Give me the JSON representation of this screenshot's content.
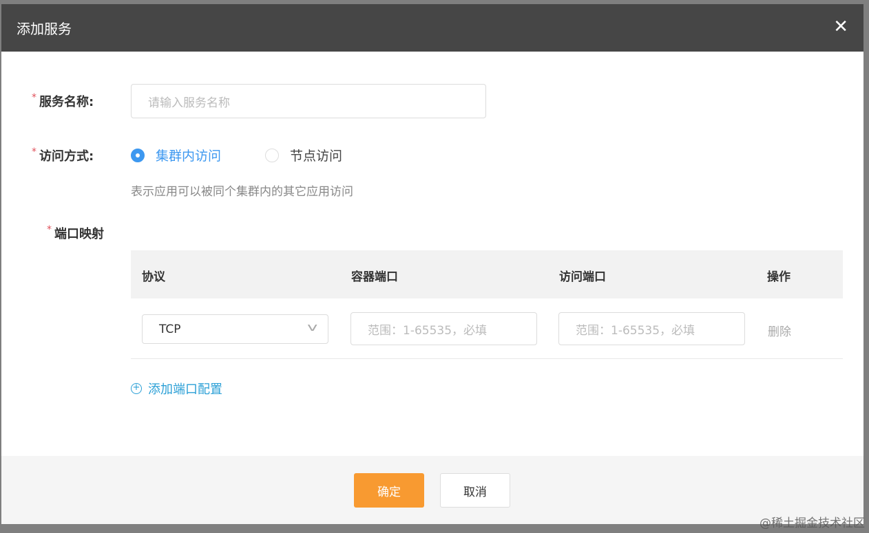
{
  "dialog": {
    "title": "添加服务",
    "close_icon": "close-icon"
  },
  "form": {
    "service_name": {
      "label": "服务名称:",
      "placeholder": "请输入服务名称",
      "value": ""
    },
    "access_mode": {
      "label": "访问方式:",
      "options": [
        "集群内访问",
        "节点访问"
      ],
      "selected": "集群内访问",
      "hint": "表示应用可以被同个集群内的其它应用访问"
    },
    "port_mapping": {
      "label": "端口映射",
      "columns": [
        "协议",
        "容器端口",
        "访问端口",
        "操作"
      ],
      "rows": [
        {
          "protocol": "TCP",
          "container_port_placeholder": "范围：1-65535，必填",
          "access_port_placeholder": "范围：1-65535，必填",
          "action": "删除"
        }
      ],
      "add_label": "添加端口配置"
    }
  },
  "footer": {
    "confirm": "确定",
    "cancel": "取消"
  },
  "watermark": "@稀土掘金技术社区",
  "colors": {
    "accent": "#3d98f0",
    "confirm": "#f89a31",
    "link": "#2a9fd6"
  }
}
